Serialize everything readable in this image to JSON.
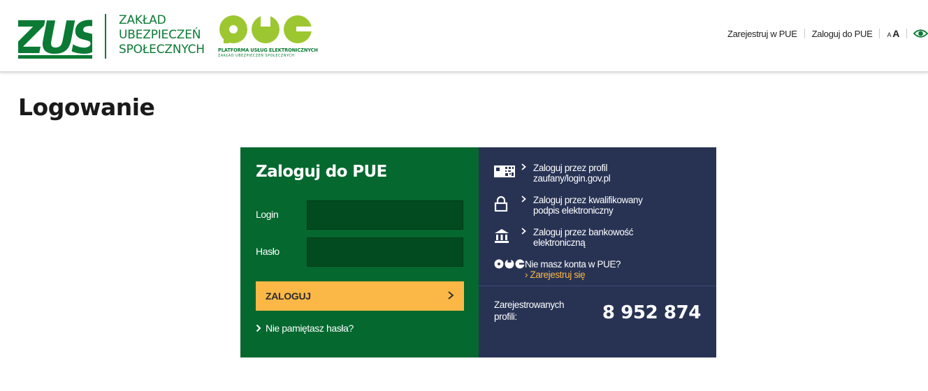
{
  "header": {
    "logo_text": "ZUS",
    "org_name_lines": [
      "ZAKŁAD",
      "UBEZPIECZEŃ",
      "SPOŁECZNYCH"
    ],
    "pue_logo_text": "PUE",
    "pue_subtitle": "PLATFORMA USŁUG ELEKTRONICZNYCH",
    "pue_subtitle2": "ZAKŁAD UBEZPIECZEŃ SPOŁECZNYCH",
    "nav": {
      "register": "Zarejestruj w PUE",
      "login": "Zaloguj do PUE",
      "font_small": "A",
      "font_big": "A"
    }
  },
  "page_title": "Logowanie",
  "login_form": {
    "title": "Zaloguj do PUE",
    "login_label": "Login",
    "login_value": "",
    "password_label": "Hasło",
    "password_value": "",
    "submit_label": "ZALOGUJ",
    "forgot_label": "Nie pamiętasz hasła?"
  },
  "alt_login": {
    "options": [
      {
        "icon": "qr-profile-icon",
        "line1": "Zaloguj przez profil",
        "line2": "zaufany/login.gov.pl"
      },
      {
        "icon": "lock-icon",
        "line1": "Zaloguj przez kwalifikowany",
        "line2": "podpis elektroniczny"
      },
      {
        "icon": "bank-icon",
        "line1": "Zaloguj przez bankowość",
        "line2": "elektroniczną"
      }
    ],
    "no_account": "Nie masz konta w PUE?",
    "register_link": "Zarejestruj się",
    "registered_label_line1": "Zarejestrowanych",
    "registered_label_line2": "profili:",
    "registered_count": "8 952 874"
  },
  "colors": {
    "brand_green": "#04682f",
    "panel_navy": "#283354",
    "accent_orange": "#fbb847"
  }
}
